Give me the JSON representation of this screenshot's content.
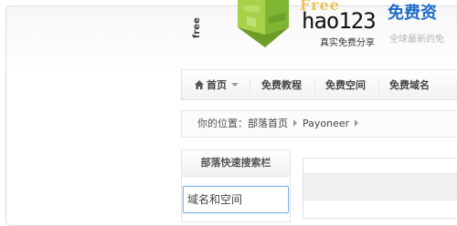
{
  "header": {
    "side_text": "free",
    "logo_decoration": "Free",
    "logo_text": "hao123",
    "logo_tagline": "真实免费分享",
    "site_title": "免费资",
    "site_subtitle": "全球最新的免"
  },
  "nav": {
    "items": [
      {
        "label": "首页",
        "icon": "home-icon"
      },
      {
        "label": "免费教程"
      },
      {
        "label": "免费空间"
      },
      {
        "label": "免费域名"
      }
    ]
  },
  "breadcrumb": {
    "prefix": "你的位置：",
    "items": [
      "部落首页",
      "Payoneer"
    ]
  },
  "sidebar": {
    "title": "部落快速搜索栏",
    "search_placeholder": "域名和空间"
  },
  "colors": {
    "title_blue": "#1f6cc6",
    "logo_green": "#8cc63f",
    "input_border": "#7fb1e6"
  }
}
